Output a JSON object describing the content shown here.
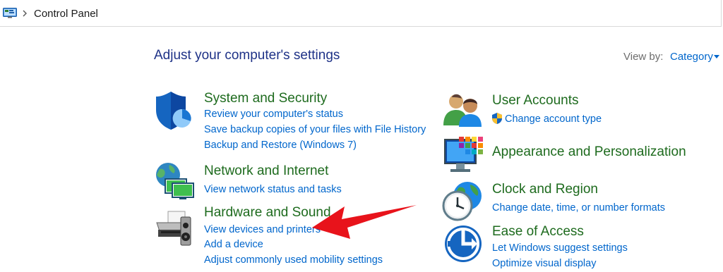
{
  "addressbar": {
    "crumbs": [
      "Control Panel"
    ],
    "icon": "control-panel-icon"
  },
  "header": {
    "title": "Adjust your computer's settings",
    "view_by_label": "View by:",
    "view_by_value": "Category"
  },
  "categories": [
    {
      "title": "System and Security",
      "icon": "shield-chart-icon",
      "links": [
        "Review your computer's status",
        "Save backup copies of your files with File History",
        "Backup and Restore (Windows 7)"
      ]
    },
    {
      "title": "Network and Internet",
      "icon": "globe-monitors-icon",
      "links": [
        "View network status and tasks"
      ]
    },
    {
      "title": "Hardware and Sound",
      "icon": "printer-speaker-icon",
      "links": [
        "View devices and printers",
        "Add a device",
        "Adjust commonly used mobility settings"
      ]
    },
    {
      "title": "User Accounts",
      "icon": "users-icon",
      "links": [
        "Change account type"
      ]
    },
    {
      "title": "Appearance and Personalization",
      "icon": "monitor-palette-icon",
      "links": []
    },
    {
      "title": "Clock and Region",
      "icon": "clock-globe-icon",
      "links": [
        "Change date, time, or number formats"
      ]
    },
    {
      "title": "Ease of Access",
      "icon": "ease-of-access-icon",
      "links": [
        "Let Windows suggest settings",
        "Optimize visual display"
      ]
    }
  ],
  "colors": {
    "title_blue": "#1e3287",
    "category_green": "#1e6b1e",
    "link_blue": "#0066cc",
    "annotation_red": "#e8131b"
  }
}
